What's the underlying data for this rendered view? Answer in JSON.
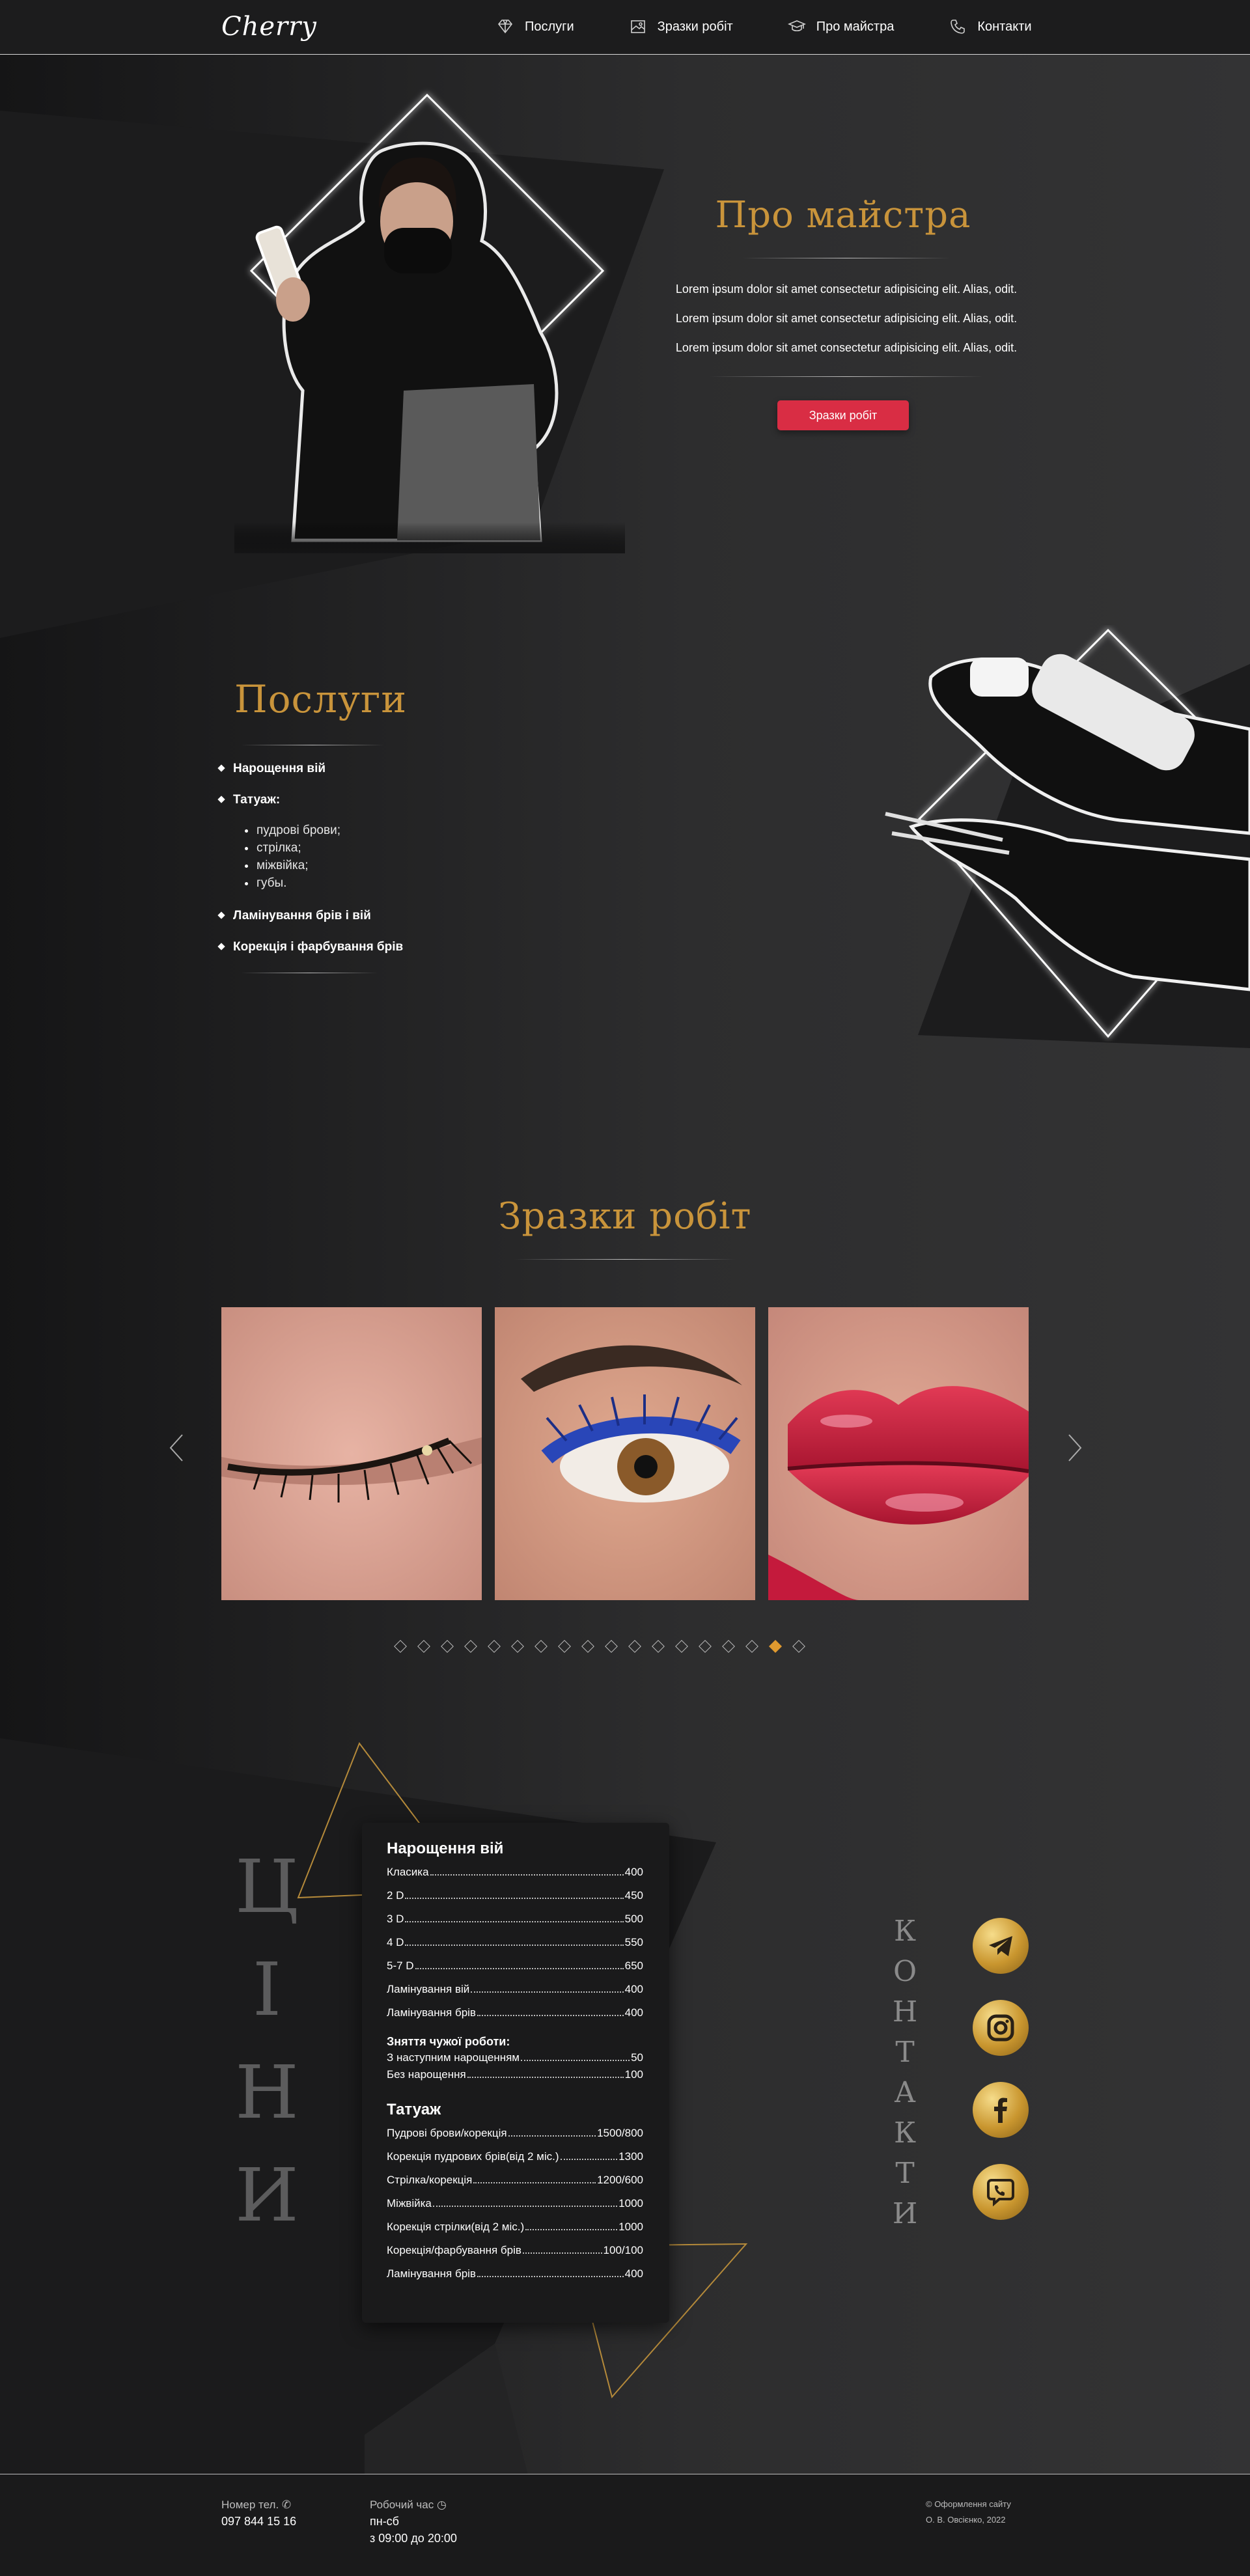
{
  "header": {
    "logo": "Cherry",
    "nav": [
      {
        "label": "Послуги",
        "icon": "diamond-icon"
      },
      {
        "label": "Зразки робіт",
        "icon": "image-icon"
      },
      {
        "label": "Про майстра",
        "icon": "graduation-cap-icon"
      },
      {
        "label": "Контакти",
        "icon": "phone-icon"
      }
    ]
  },
  "about": {
    "title": "Про майстра",
    "paragraphs": [
      "Lorem ipsum dolor sit amet consectetur adipisicing elit. Alias, odit.",
      "Lorem ipsum dolor sit amet consectetur adipisicing elit. Alias, odit.",
      "Lorem ipsum dolor sit amet consectetur adipisicing elit. Alias, odit."
    ],
    "button": "Зразки робіт"
  },
  "services": {
    "title": "Послуги",
    "items": [
      "Нарощення вій",
      "Татуаж:",
      "Ламінування брів і вій",
      "Корекція і фарбування брів"
    ],
    "tattoo_sub": [
      "пудрові брови;",
      "стрілка;",
      "міжвійка;",
      "губы."
    ]
  },
  "works": {
    "title": "Зразки робіт",
    "photos": [
      "lashes-photo",
      "blue-lashes-photo",
      "lips-photo"
    ],
    "dot_count": 18,
    "active_dot": 16
  },
  "prices": {
    "vertical_title": [
      "Ц",
      "І",
      "Н",
      "И"
    ],
    "lashes": {
      "title": "Нарощення вій",
      "rows": [
        {
          "name": "Класика",
          "price": "400"
        },
        {
          "name": "2 D",
          "price": "450"
        },
        {
          "name": "3 D",
          "price": "500"
        },
        {
          "name": "4 D",
          "price": "550"
        },
        {
          "name": "5-7 D",
          "price": "650"
        },
        {
          "name": "Ламінування вій",
          "price": "400"
        },
        {
          "name": "Ламінування брів",
          "price": "400"
        }
      ],
      "removal_title": "Зняття чужої роботи:",
      "removal_rows": [
        {
          "name": "З наступним нарощенням",
          "price": "50"
        },
        {
          "name": "Без нарощення",
          "price": "100"
        }
      ]
    },
    "tattoo": {
      "title": "Татуаж",
      "rows": [
        {
          "name": "Пудрові брови/корекція",
          "price": "1500/800"
        },
        {
          "name": "Корекція пудрових брів(від 2 міс.)",
          "price": "1300"
        },
        {
          "name": "Стрілка/корекція",
          "price": "1200/600"
        },
        {
          "name": "Міжвійка",
          "price": "1000"
        },
        {
          "name": "Корекція стрілки(від 2 міс.)",
          "price": "1000"
        },
        {
          "name": "Корекція/фарбування брів",
          "price": "100/100"
        },
        {
          "name": "Ламінування брів",
          "price": "400"
        }
      ]
    }
  },
  "contacts": {
    "vertical_title": [
      "К",
      "О",
      "Н",
      "Т",
      "А",
      "К",
      "Т",
      "И"
    ],
    "socials": [
      "telegram-icon",
      "instagram-icon",
      "facebook-icon",
      "viber-icon"
    ]
  },
  "footer": {
    "phone_label": "Номер тел.",
    "phone": "097 844 15 16",
    "hours_label": "Робочий час",
    "days": "пн-сб",
    "hours": "з 09:00 до 20:00",
    "copyright1": "© Оформлення сайту",
    "copyright2": "О. В. Овсієнко, 2022"
  },
  "colors": {
    "gold": "#c9943b",
    "accent_red": "#d92d44",
    "active_dot": "#e09a2f"
  }
}
